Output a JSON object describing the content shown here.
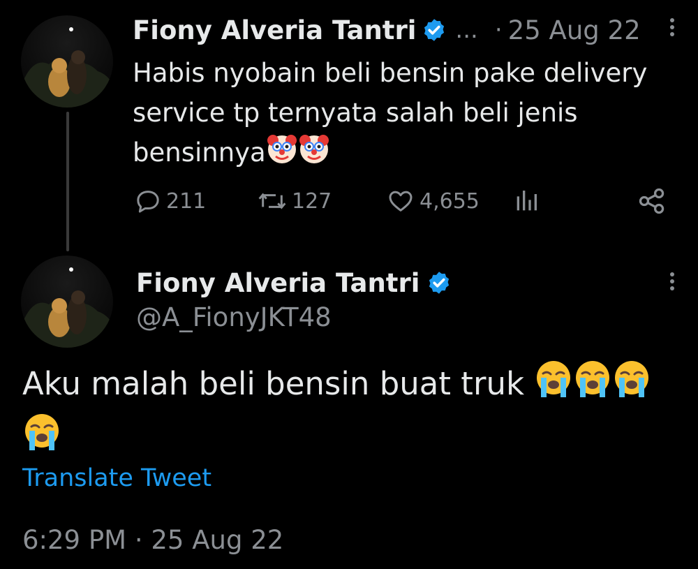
{
  "tweet1": {
    "author_name": "Fiony Alveria Tantri",
    "ellipsis": "...",
    "separator": "·",
    "date": "25 Aug 22",
    "text": "Habis nyobain beli bensin pake delivery service tp ternyata salah beli jenis bensinnya",
    "emoji_count": 2,
    "stats": {
      "replies": "211",
      "retweets": "127",
      "likes": "4,655"
    }
  },
  "tweet2": {
    "author_name": "Fiony Alveria Tantri",
    "handle": "@A_FionyJKT48",
    "text": "Aku malah beli bensin buat truk",
    "emoji_count": 4,
    "translate_label": "Translate Tweet",
    "timestamp": "6:29 PM · 25 Aug 22"
  },
  "colors": {
    "background": "#000000",
    "text_primary": "#e7e9ea",
    "text_muted": "#8b8f94",
    "link": "#1d9bf0",
    "verified": "#1d9bf0"
  },
  "icons": {
    "reply": "reply-icon",
    "retweet": "retweet-icon",
    "like": "heart-icon",
    "views": "views-icon",
    "share": "share-icon",
    "verified": "verified-badge-icon",
    "more": "more-options-icon",
    "clown": "clown-face-emoji",
    "crying": "loudly-crying-face-emoji"
  }
}
